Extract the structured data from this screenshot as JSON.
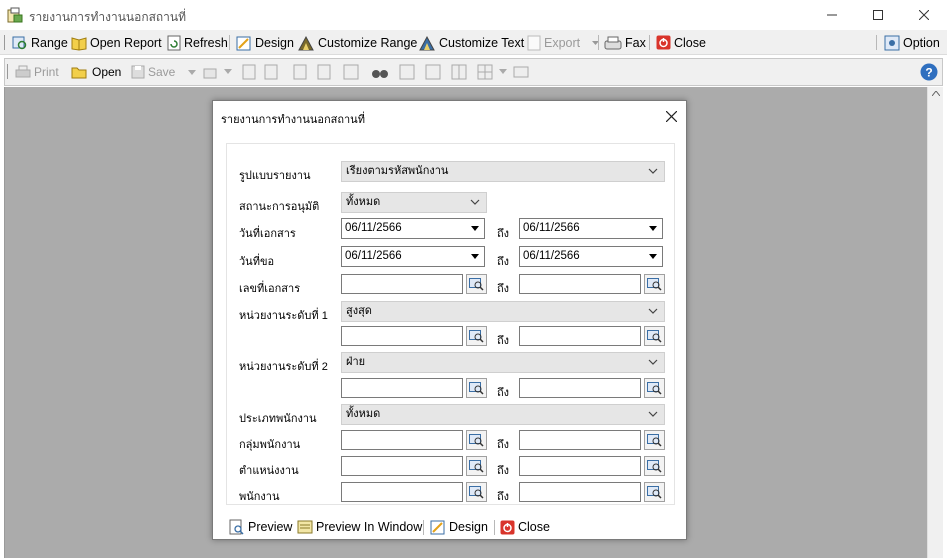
{
  "window": {
    "title": "รายงานการทำงานนอกสถานที่"
  },
  "toolbar": {
    "range": "Range",
    "open_report": "Open Report",
    "refresh": "Refresh",
    "design": "Design",
    "customize_range": "Customize Range",
    "customize_text": "Customize Text",
    "export": "Export",
    "fax": "Fax",
    "close": "Close",
    "option": "Option"
  },
  "viewer_toolbar": {
    "print": "Print",
    "open": "Open",
    "save": "Save"
  },
  "dialog": {
    "title": "รายงานการทำงานนอกสถานที่",
    "to_label": "ถึง",
    "fields": {
      "report_format": {
        "label": "รูปแบบรายงาน",
        "value": "เรียงตามรหัสพนักงาน"
      },
      "approval_status": {
        "label": "สถานะการอนุมัติ",
        "value": "ทั้งหมด"
      },
      "document_date": {
        "label": "วันที่เอกสาร",
        "from": "06/11/2566",
        "to": "06/11/2566"
      },
      "request_date": {
        "label": "วันที่ขอ",
        "from": "06/11/2566",
        "to": "06/11/2566"
      },
      "document_no": {
        "label": "เลขที่เอกสาร"
      },
      "unit_level1": {
        "label": "หน่วยงานระดับที่ 1",
        "value": "สูงสุด"
      },
      "unit_level2": {
        "label": "หน่วยงานระดับที่ 2",
        "value": "ฝ่าย"
      },
      "employee_type": {
        "label": "ประเภทพนักงาน",
        "value": "ทั้งหมด"
      },
      "employee_group": {
        "label": "กลุ่มพนักงาน"
      },
      "position": {
        "label": "ตำแหน่งงาน"
      },
      "employee": {
        "label": "พนักงาน"
      }
    },
    "footer": {
      "preview": "Preview",
      "preview_window": "Preview In Window",
      "design": "Design",
      "close": "Close"
    }
  },
  "colors": {
    "workspace": "#ababab",
    "close_red": "#d9342b",
    "help_blue": "#2f6fbf"
  }
}
